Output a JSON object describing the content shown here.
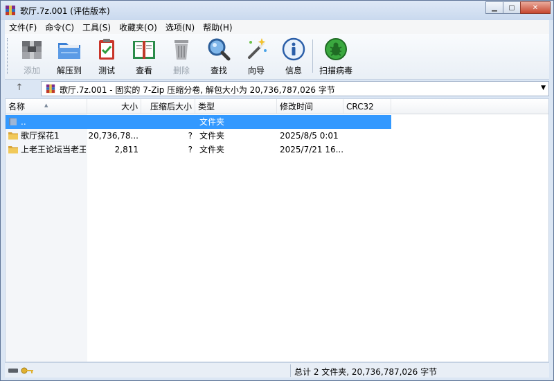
{
  "window": {
    "title": "歌厅.7z.001 (评估版本)",
    "controls": {
      "minimize": "▁",
      "maximize": "▢",
      "close": "✕"
    }
  },
  "menu": [
    "文件(F)",
    "命令(C)",
    "工具(S)",
    "收藏夹(O)",
    "选项(N)",
    "帮助(H)"
  ],
  "toolbar": [
    {
      "label": "添加",
      "icon": "add-archive-icon",
      "disabled": true
    },
    {
      "label": "解压到",
      "icon": "extract-folder-icon",
      "disabled": false
    },
    {
      "label": "测试",
      "icon": "test-clipboard-icon",
      "disabled": false
    },
    {
      "label": "查看",
      "icon": "view-book-icon",
      "disabled": false
    },
    {
      "label": "删除",
      "icon": "delete-trash-icon",
      "disabled": true
    },
    {
      "label": "查找",
      "icon": "find-magnifier-icon",
      "disabled": false
    },
    {
      "label": "向导",
      "icon": "wizard-wand-icon",
      "disabled": false
    },
    {
      "label": "信息",
      "icon": "info-icon",
      "disabled": false
    },
    {
      "label": "扫描病毒",
      "icon": "scan-virus-icon",
      "disabled": false
    }
  ],
  "address": {
    "up": "↑",
    "text": "歌厅.7z.001 - 固实的 7-Zip 压缩分卷, 解包大小为 20,736,787,026 字节",
    "dropdown": "▼"
  },
  "columns": {
    "name": "名称",
    "size": "大小",
    "packed": "压缩后大小",
    "type": "类型",
    "modified": "修改时间",
    "crc": "CRC32"
  },
  "rows": [
    {
      "name": "..",
      "size": "",
      "packed": "",
      "type": "文件夹",
      "modified": "",
      "crc": ""
    },
    {
      "name": "歌厅探花1",
      "size": "20,736,78...",
      "packed": "?",
      "type": "文件夹",
      "modified": "2025/8/5 0:01",
      "crc": ""
    },
    {
      "name": "上老王论坛当老王",
      "size": "2,811",
      "packed": "?",
      "type": "文件夹",
      "modified": "2025/7/21 16...",
      "crc": ""
    }
  ],
  "status": {
    "summary": "总计 2 文件夹, 20,736,787,026 字节"
  },
  "colors": {
    "selection": "#3399ff",
    "window_frame": "#dbe6f4",
    "title_close": "#c7472f"
  }
}
